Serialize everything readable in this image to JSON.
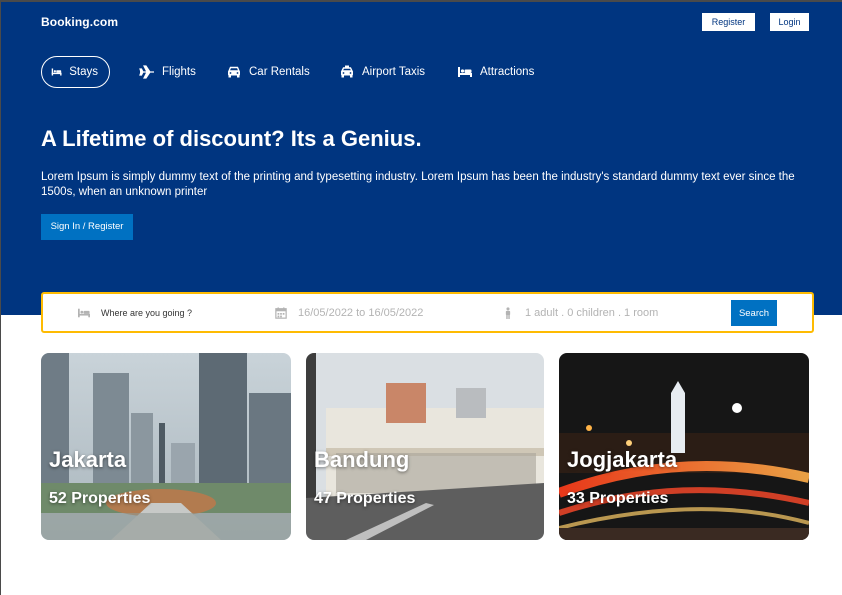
{
  "header": {
    "logo": "Booking.com",
    "register_label": "Register",
    "login_label": "Login"
  },
  "nav": [
    {
      "label": "Stays",
      "icon": "bed-icon",
      "active": true
    },
    {
      "label": "Flights",
      "icon": "plane-icon",
      "active": false
    },
    {
      "label": "Car Rentals",
      "icon": "car-icon",
      "active": false
    },
    {
      "label": "Airport Taxis",
      "icon": "taxi-icon",
      "active": false
    },
    {
      "label": "Attractions",
      "icon": "bed-icon",
      "active": false
    }
  ],
  "hero": {
    "headline": "A Lifetime of discount? Its a Genius.",
    "description": "Lorem Ipsum is simply dummy text of the printing and typesetting industry. Lorem Ipsum has been the industry's standard dummy text ever since the 1500s, when an unknown printer",
    "cta_label": "Sign In / Register"
  },
  "search": {
    "destination_placeholder": "Where are you going ?",
    "dates": "16/05/2022 to 16/05/2022",
    "guests": "1 adult . 0 children . 1 room",
    "button_label": "Search"
  },
  "destinations": [
    {
      "name": "Jakarta",
      "properties": "52 Properties"
    },
    {
      "name": "Bandung",
      "properties": "47 Properties"
    },
    {
      "name": "Jogjakarta",
      "properties": "33 Properties"
    }
  ],
  "colors": {
    "brand_blue": "#003580",
    "button_blue": "#0071c2",
    "search_border": "#febb02"
  }
}
